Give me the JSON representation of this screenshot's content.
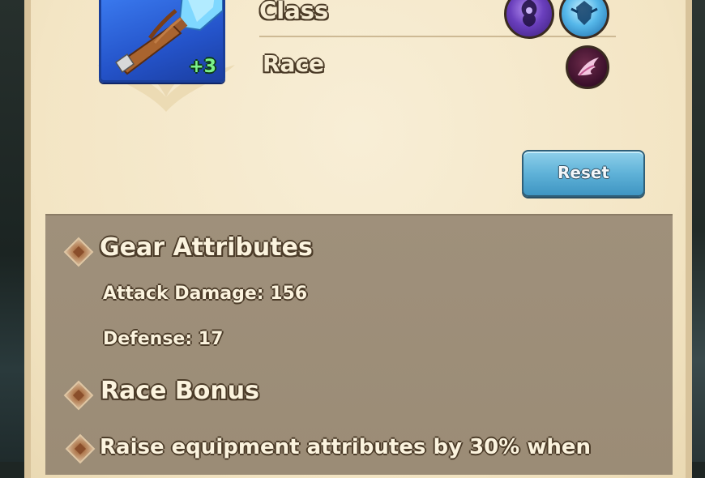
{
  "equipment": {
    "level_label": "+3"
  },
  "filters": {
    "class_label": "Class",
    "race_label": "Race",
    "class_icons": [
      "purple-class-icon",
      "blue-class-icon"
    ],
    "race_icon": "winged-race-icon"
  },
  "actions": {
    "reset_label": "Reset"
  },
  "gear_attributes": {
    "title": "Gear Attributes",
    "attack_damage": "Attack Damage: 156",
    "defense": "Defense: 17"
  },
  "race_bonus": {
    "title": "Race Bonus",
    "description": "Raise equipment attributes by 30% when"
  },
  "colors": {
    "panel_bg": "#f5e9cc",
    "attr_panel_bg": "#9f907b",
    "reset_button": "#5fb2d8",
    "level_green": "#7cf28a",
    "card_blue": "#2453c9"
  }
}
